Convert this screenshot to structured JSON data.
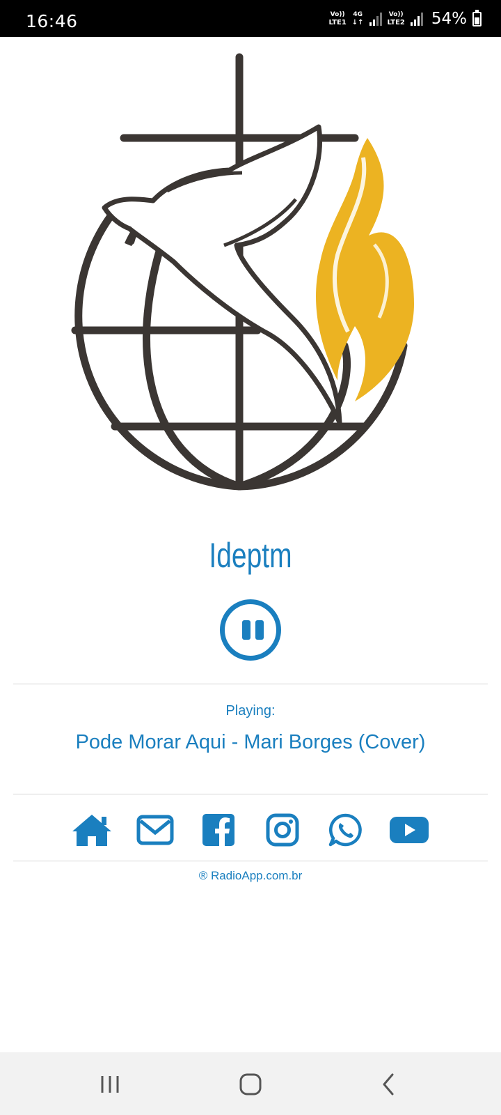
{
  "status_bar": {
    "time": "16:46",
    "sim1_top": "Vo))",
    "sim1_bottom": "LTE1",
    "network_top": "4G",
    "network_bottom": "↓↑",
    "sim2_top": "Vo))",
    "sim2_bottom": "LTE2",
    "battery": "54%",
    "icons": [
      "signal-icon",
      "battery-charging-icon"
    ]
  },
  "station": {
    "logo": "church-logo",
    "name": "Ideptm"
  },
  "player": {
    "button_state": "pause-icon",
    "playing_label": "Playing:",
    "track": "Pode Morar Aqui - Mari Borges (Cover)"
  },
  "social": [
    "home-icon",
    "mail-icon",
    "facebook-icon",
    "instagram-icon",
    "whatsapp-icon",
    "youtube-icon"
  ],
  "footer": {
    "credit": "® RadioApp.com.br"
  },
  "nav": [
    "recent-apps-icon",
    "home-nav-icon",
    "back-icon"
  ],
  "colors": {
    "accent": "#1a7fbf",
    "logo_dark": "#3b3633",
    "logo_flame": "#ecb322"
  }
}
